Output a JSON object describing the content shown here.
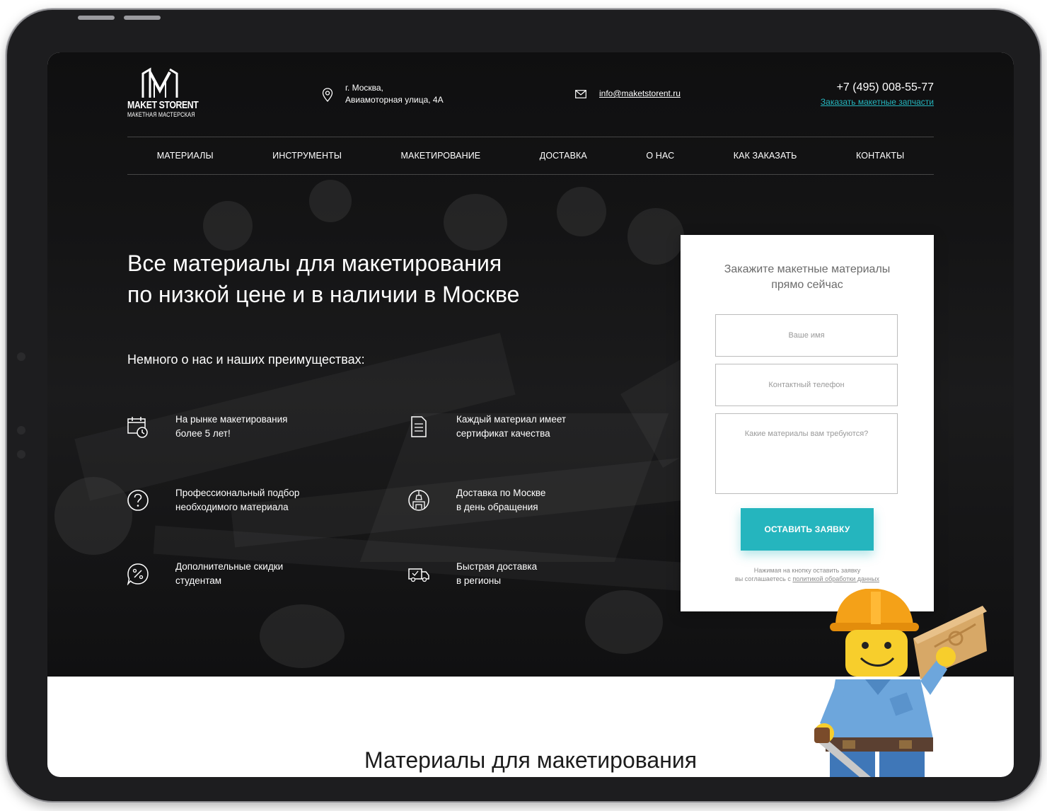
{
  "header": {
    "logo": {
      "word": "MAKET STORENT",
      "sub": "МАКЕТНАЯ МАСТЕРСКАЯ"
    },
    "address": {
      "line1": "г. Москва,",
      "line2": "Авиамоторная улица, 4А"
    },
    "email": "info@maketstorent.ru",
    "phone": "+7 (495) 008-55-77",
    "order_link": "Заказать макетные запчасти"
  },
  "nav": [
    {
      "label": "МАТЕРИАЛЫ"
    },
    {
      "label": "ИНСТРУМЕНТЫ"
    },
    {
      "label": "МАКЕТИРОВАНИЕ"
    },
    {
      "label": "ДОСТАВКА"
    },
    {
      "label": "О НАС"
    },
    {
      "label": "КАК ЗАКАЗАТЬ"
    },
    {
      "label": "КОНТАКТЫ"
    }
  ],
  "hero": {
    "title_line1": "Все материалы для макетирования",
    "title_line2": "по низкой цене и в наличии в Москве",
    "subtitle": "Немного о нас и наших преимуществах:"
  },
  "features": [
    {
      "line1": "На рынке макетирования",
      "line2": "более 5 лет!",
      "icon": "calendar-clock-icon"
    },
    {
      "line1": "Каждый материал имеет",
      "line2": "сертификат качества",
      "icon": "document-icon"
    },
    {
      "line1": "Профессиональный подбор",
      "line2": "необходимого материала",
      "icon": "question-circle-icon"
    },
    {
      "line1": "Доставка по Москве",
      "line2": "в день обращения",
      "icon": "kremlin-icon"
    },
    {
      "line1": "Дополнительные скидки",
      "line2": "студентам",
      "icon": "discount-badge-icon"
    },
    {
      "line1": "Быстрая доставка",
      "line2": "в регионы",
      "icon": "delivery-truck-icon"
    }
  ],
  "form": {
    "title_line1": "Закажите макетные материалы",
    "title_line2": "прямо сейчас",
    "name_placeholder": "Ваше имя",
    "phone_placeholder": "Контактный телефон",
    "materials_placeholder": "Какие материалы вам требуются?",
    "submit": "ОСТАВИТЬ ЗАЯВКУ",
    "consent_line1": "Нажимая на кнопку оставить заявку",
    "consent_prefix": "вы соглашаетесь с",
    "consent_link": "политикой обработки данных"
  },
  "section_title": "Материалы для макетирования",
  "colors": {
    "accent": "#25b5be",
    "link": "#25b5be",
    "hero_bg": "#141415"
  }
}
